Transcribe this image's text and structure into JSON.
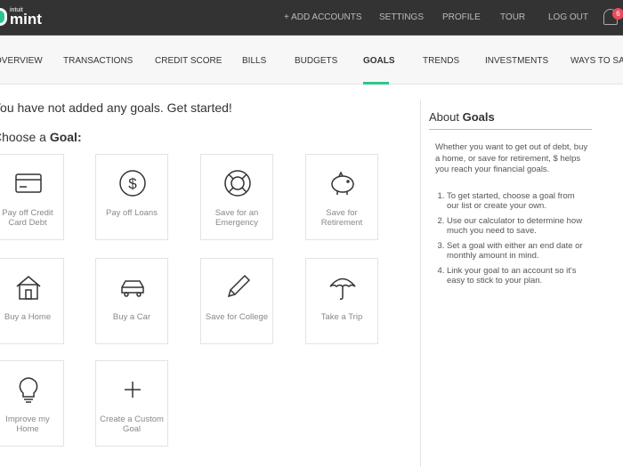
{
  "header": {
    "logo_small": "intuit",
    "logo_large": "mint",
    "links": [
      "+ ADD ACCOUNTS",
      "SETTINGS",
      "PROFILE",
      "TOUR",
      "LOG OUT"
    ],
    "notification_count": "6",
    "accent": "#2bc68b"
  },
  "nav": {
    "items": [
      "OVERVIEW",
      "TRANSACTIONS",
      "CREDIT SCORE",
      "BILLS",
      "BUDGETS",
      "GOALS",
      "TRENDS",
      "INVESTMENTS",
      "WAYS TO SAVE"
    ],
    "active": "GOALS"
  },
  "main": {
    "headline": "You have not added any goals. Get started!",
    "choose_prefix": "Choose a ",
    "choose_bold": "Goal:",
    "goals": [
      {
        "label": "Pay off Credit Card Debt",
        "icon": "credit-card"
      },
      {
        "label": "Pay off Loans",
        "icon": "dollar-circle"
      },
      {
        "label": "Save for an Emergency",
        "icon": "life-ring"
      },
      {
        "label": "Save for Retirement",
        "icon": "piggy-bank"
      },
      {
        "label": "Buy a Home",
        "icon": "house"
      },
      {
        "label": "Buy a Car",
        "icon": "car"
      },
      {
        "label": "Save for College",
        "icon": "pencil"
      },
      {
        "label": "Take a Trip",
        "icon": "umbrella"
      },
      {
        "label": "Improve my Home",
        "icon": "lightbulb"
      },
      {
        "label": "Create a Custom Goal",
        "icon": "plus"
      }
    ]
  },
  "sidebar": {
    "title_prefix": "About ",
    "title_bold": "Goals",
    "intro": "Whether you want to get out of debt, buy a home, or save for retirement, $ helps you reach your financial goals.",
    "steps": [
      "To get started, choose a goal from our list or create your own.",
      "Use our calculator to determine how much you need to save.",
      "Set a goal with either an end date or monthly amount in mind.",
      "Link your goal to an account so it's easy to stick to your plan."
    ]
  }
}
